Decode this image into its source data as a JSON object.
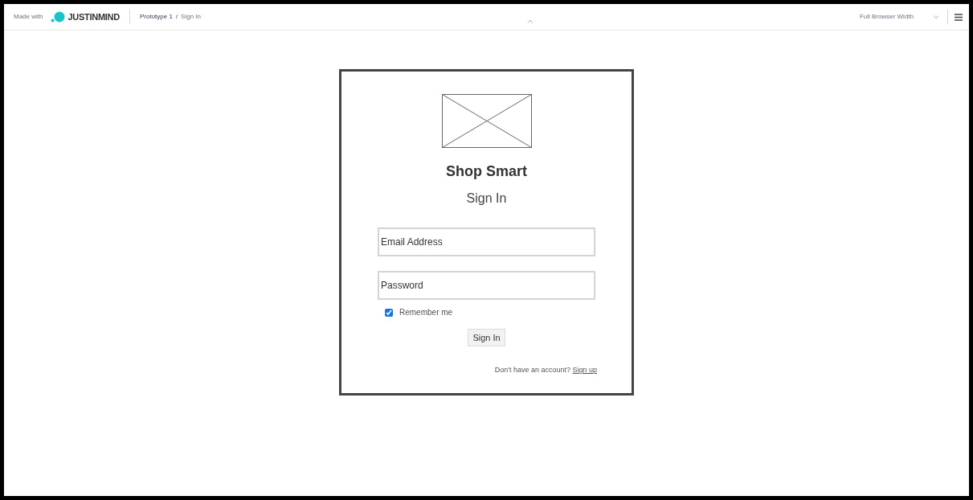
{
  "top_bar": {
    "made_with": "Made with",
    "brand": "JUSTINMIND",
    "breadcrumb": [
      {
        "label": "Prototype 1",
        "selected": false
      },
      {
        "label": "/",
        "selected": false
      },
      {
        "label": "Sign In",
        "selected": true
      }
    ],
    "view_mode": "Full Browser Width"
  },
  "card": {
    "title": "Shop Smart",
    "subtitle": "Sign In",
    "fields": [
      {
        "placeholder": "Email Address"
      },
      {
        "placeholder": "Password"
      }
    ],
    "remember": {
      "label": "Remember me",
      "checked": true
    },
    "button": "Sign In",
    "footer": {
      "text": "Don't have an account?",
      "link": "Sign up"
    }
  }
}
